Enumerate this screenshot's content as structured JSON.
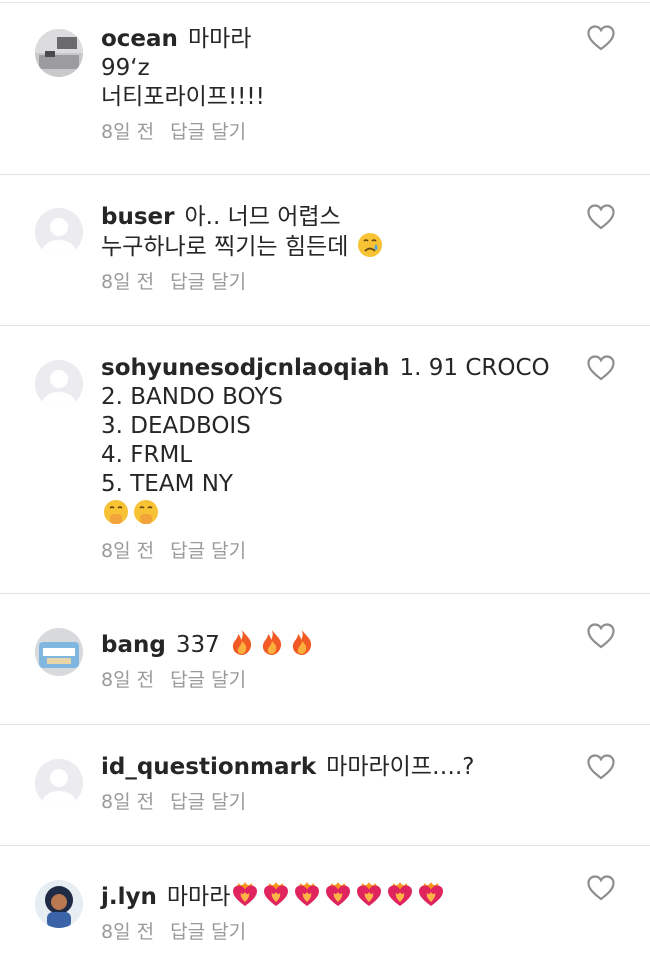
{
  "comments": [
    {
      "username": "ocean",
      "lines": [
        "마마라",
        "99‘z",
        "너티포라이프!!!!"
      ],
      "emoji_after": [],
      "time": "8일 전",
      "reply": "답글 달기",
      "avatar": "photo-room-avatar"
    },
    {
      "username": "buser",
      "lines": [
        "아.. 너므 어렵스",
        "누구하나로 찍기는 힘든데"
      ],
      "emoji_after": [
        "crying-face-icon"
      ],
      "time": "8일 전",
      "reply": "답글 달기",
      "avatar": "default-avatar"
    },
    {
      "username": "sohyunesodjcnlaoqiah",
      "lines": [
        "1. 91 CROCO",
        "2. BANDO BOYS",
        "3. DEADBOIS",
        "4. FRML",
        "5. TEAM NY"
      ],
      "emoji_after": [
        "hand-over-mouth-icon",
        "hand-over-mouth-icon"
      ],
      "time": "8일 전",
      "reply": "답글 달기",
      "avatar": "default-avatar"
    },
    {
      "username": "bang",
      "lines": [
        "337"
      ],
      "emoji_after": [
        "fire-icon",
        "fire-icon",
        "fire-icon"
      ],
      "time": "8일 전",
      "reply": "답글 달기",
      "avatar": "snack-avatar"
    },
    {
      "username": "id_questionmark",
      "lines": [
        "마마라이프….?"
      ],
      "emoji_after": [],
      "time": "8일 전",
      "reply": "답글 달기",
      "avatar": "default-avatar"
    },
    {
      "username": "j.lyn",
      "lines": [
        "마마라"
      ],
      "emoji_after": [
        "heart-on-fire-icon",
        "heart-on-fire-icon",
        "heart-on-fire-icon",
        "heart-on-fire-icon",
        "heart-on-fire-icon",
        "heart-on-fire-icon",
        "heart-on-fire-icon"
      ],
      "time": "8일 전",
      "reply": "답글 달기",
      "avatar": "illustrated-avatar"
    }
  ],
  "colors": {
    "text": "#262626",
    "meta": "#9a9a9a",
    "divider": "#e3e3e3",
    "heart_outline": "#262626"
  }
}
